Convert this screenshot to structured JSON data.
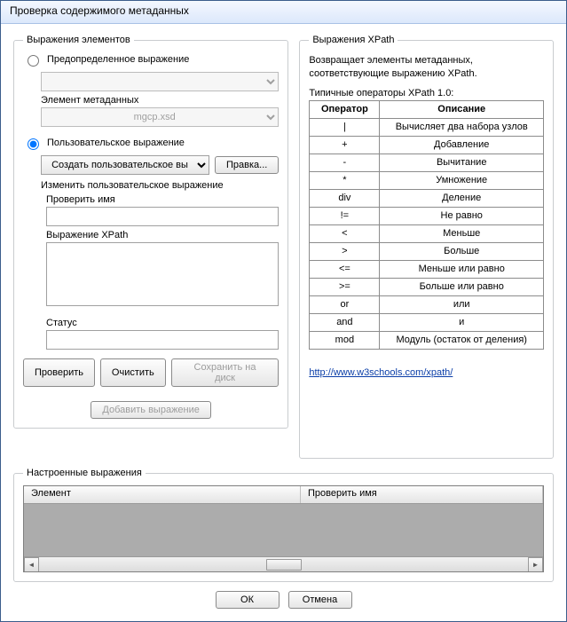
{
  "window": {
    "title": "Проверка содержимого метаданных"
  },
  "left": {
    "group_title": "Выражения элементов",
    "radio_predef": "Предопределенное выражение",
    "predef_ddl": "",
    "meta_element_label": "Элемент метаданных",
    "meta_element_value": "mgcp.xsd",
    "radio_custom": "Пользовательское выражение",
    "custom_ddl": "Создать пользовательское вы",
    "edit_btn": "Правка...",
    "modify_label": "Изменить пользовательское выражение",
    "check_name_label": "Проверить имя",
    "check_name_value": "",
    "xpath_label": "Выражение XPath",
    "xpath_value": "",
    "status_label": "Статус",
    "status_value": "",
    "btn_check": "Проверить",
    "btn_clear": "Очистить",
    "btn_save": "Сохранить на диск",
    "btn_add": "Добавить выражение"
  },
  "right": {
    "group_title": "Выражения XPath",
    "desc": "Возвращает элементы метаданных, соответствующие выражению XPath.",
    "ops_caption": "Типичные операторы XPath 1.0:",
    "headers": {
      "op": "Оператор",
      "desc": "Описание"
    },
    "rows": [
      {
        "op": "|",
        "desc": "Вычисляет два набора узлов"
      },
      {
        "op": "+",
        "desc": "Добавление"
      },
      {
        "op": "-",
        "desc": "Вычитание"
      },
      {
        "op": "*",
        "desc": "Умножение"
      },
      {
        "op": "div",
        "desc": "Деление"
      },
      {
        "op": "!=",
        "desc": "Не равно"
      },
      {
        "op": "<",
        "desc": "Меньше"
      },
      {
        "op": ">",
        "desc": "Больше"
      },
      {
        "op": "<=",
        "desc": "Меньше или равно"
      },
      {
        "op": ">=",
        "desc": "Больше или равно"
      },
      {
        "op": "or",
        "desc": "или"
      },
      {
        "op": "and",
        "desc": "и"
      },
      {
        "op": "mod",
        "desc": "Модуль (остаток от деления)"
      }
    ],
    "link_text": "http://www.w3schools.com/xpath/"
  },
  "configured": {
    "group_title": "Настроенные выражения",
    "col_element": "Элемент",
    "col_checkname": "Проверить имя"
  },
  "footer": {
    "ok": "ОК",
    "cancel": "Отмена"
  }
}
